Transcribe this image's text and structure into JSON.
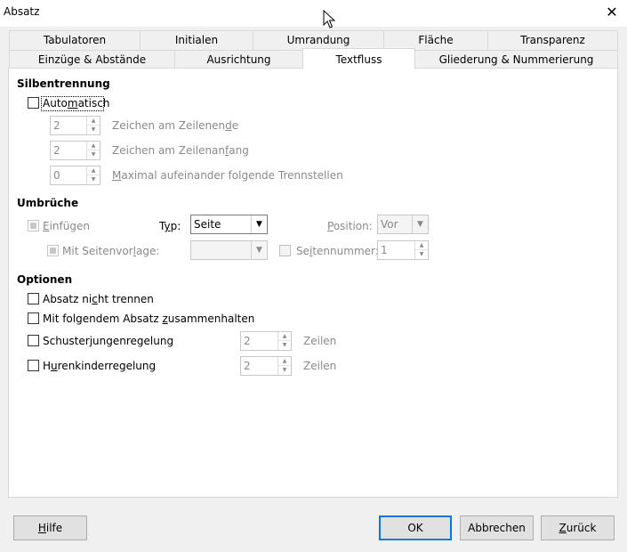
{
  "window": {
    "title": "Absatz",
    "close_glyph": "✕"
  },
  "tabs": {
    "row1": [
      "Tabulatoren",
      "Initialen",
      "Umrandung",
      "Fläche",
      "Transparenz"
    ],
    "row2": [
      "Einzüge & Abstände",
      "Ausrichtung",
      "Textfluss",
      "Gliederung & Nummerierung"
    ],
    "active": "Textfluss"
  },
  "hyphenation": {
    "title": "Silbentrennung",
    "automatic": {
      "pre": "Auto",
      "ul": "m",
      "post": "atisch",
      "checked": false
    },
    "fields": [
      {
        "value": "2",
        "label_pre": "Zeichen am Zeilenen",
        "ul": "d",
        "label_post": "e"
      },
      {
        "value": "2",
        "label_pre": "Zeichen am Zeilenan",
        "ul": "f",
        "label_post": "ang"
      },
      {
        "value": "0",
        "label_pre": "",
        "ul": "M",
        "label_post": "aximal aufeinander folgende Trennstellen"
      }
    ]
  },
  "breaks": {
    "title": "Umbrüche",
    "insert": {
      "pre": "",
      "ul": "E",
      "post": "infügen",
      "checked": true,
      "disabled": true
    },
    "type": {
      "pre": "T",
      "ul": "y",
      "post": "p:",
      "value": "Seite"
    },
    "position": {
      "pre": "",
      "ul": "P",
      "post": "osition:",
      "value": "Vor"
    },
    "with_page_style": {
      "pre": "Mit Seitenvor",
      "ul": "l",
      "post": "age:",
      "checked": true,
      "value": ""
    },
    "page_number": {
      "pre": "Se",
      "ul": "i",
      "post": "tennummer:",
      "checked": false,
      "value": "1"
    }
  },
  "options": {
    "title": "Optionen",
    "items": [
      {
        "pre": "Absatz ni",
        "ul": "c",
        "post": "ht trennen",
        "checked": false
      },
      {
        "pre": "Mit folgendem Absatz ",
        "ul": "z",
        "post": "usammenhalten",
        "checked": false
      },
      {
        "pre": "Schuster",
        "ul": "j",
        "post": "ungenregelung",
        "checked": false,
        "value": "2",
        "unit": "Zeilen"
      },
      {
        "pre": "H",
        "ul": "u",
        "post": "renkinderregelung",
        "checked": false,
        "value": "2",
        "unit": "Zeilen"
      }
    ]
  },
  "buttons": {
    "help": {
      "pre": "",
      "ul": "H",
      "post": "ilfe"
    },
    "ok": "OK",
    "cancel": "Abbrechen",
    "reset": {
      "pre": "",
      "ul": "Z",
      "post": "urück"
    }
  },
  "colors": {
    "accent": "#0078d7",
    "disabled_text": "#8a8a8a",
    "panel_bg": "#ffffff",
    "dialog_bg": "#f0f0f0"
  }
}
